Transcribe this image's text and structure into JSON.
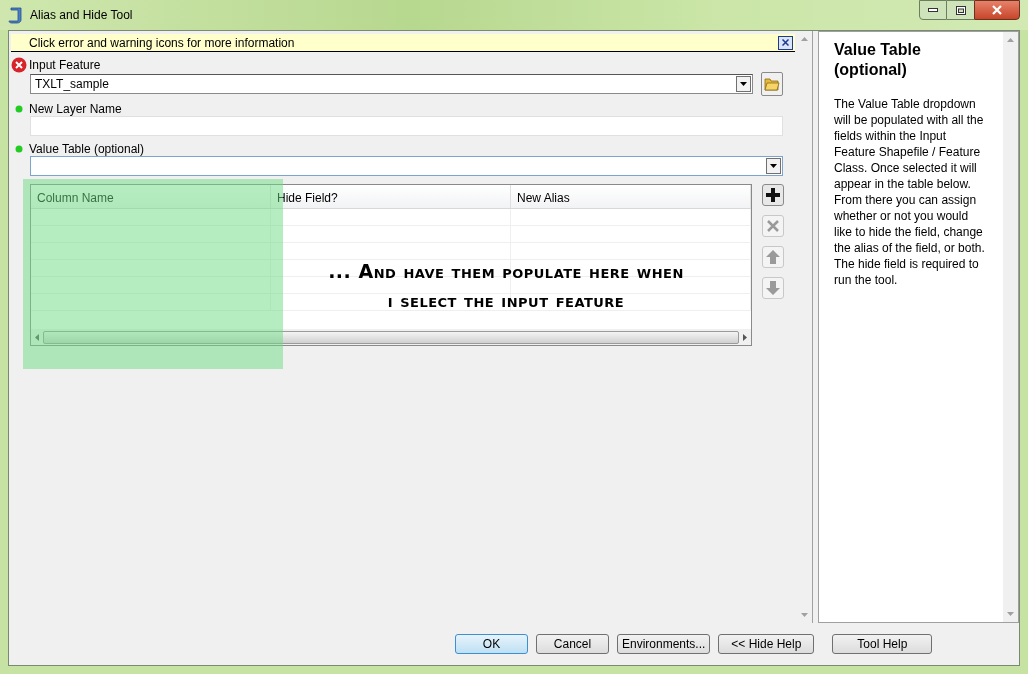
{
  "window": {
    "title": "Alias and Hide Tool"
  },
  "message_bar": {
    "text": "Click error and warning icons for more information"
  },
  "parameters": [
    {
      "label": "Input Feature",
      "error": true,
      "kind": "dropdown-browse",
      "value": "TXLT_sample"
    },
    {
      "label": "New Layer Name",
      "error": false,
      "kind": "text"
    },
    {
      "label": "Value Table (optional)",
      "error": false,
      "kind": "dropdown"
    }
  ],
  "value_table": {
    "columns": [
      "Column Name",
      "Hide Field?",
      "New Alias"
    ]
  },
  "table_buttons": [
    {
      "kind": "add",
      "disabled": false
    },
    {
      "kind": "delete",
      "disabled": true
    },
    {
      "kind": "up",
      "disabled": true
    },
    {
      "kind": "down",
      "disabled": true
    }
  ],
  "annotation": {
    "lines": [
      "... And have them populate here when",
      "i select the input feature"
    ]
  },
  "help": {
    "title": "Value Table (optional)",
    "body": "The Value Table dropdown will be populated with all the fields within the Input Feature Shapefile / Feature Class. Once selected it will appear in the table below. From there you can assign whether or not you would like to hide the field, change the alias of the field, or both. The hide field is required to run the tool."
  },
  "buttons": [
    {
      "label": "OK",
      "default": true
    },
    {
      "label": "Cancel",
      "default": false
    },
    {
      "label": "Environments...",
      "default": false
    },
    {
      "label": "<< Hide Help",
      "default": false
    }
  ],
  "tool_help_button": {
    "label": "Tool Help"
  }
}
